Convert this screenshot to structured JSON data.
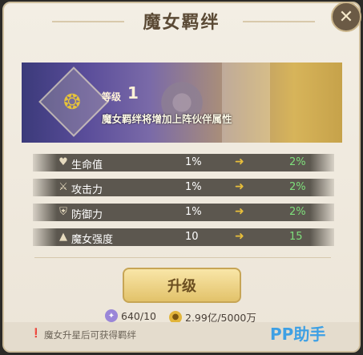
{
  "title": "魔女羁绊",
  "banner": {
    "level_label": "等级",
    "level_value": "1",
    "description": "魔女羁绊将增加上阵伙伴属性"
  },
  "stats": [
    {
      "icon": "heart-icon",
      "label": "生命值",
      "current": "1%",
      "next": "2%"
    },
    {
      "icon": "sword-icon",
      "label": "攻击力",
      "current": "1%",
      "next": "2%"
    },
    {
      "icon": "shield-icon",
      "label": "防御力",
      "current": "1%",
      "next": "2%"
    },
    {
      "icon": "witch-hat-icon",
      "label": "魔女强度",
      "current": "10",
      "next": "15"
    }
  ],
  "upgrade_label": "升级",
  "costs": [
    {
      "icon": "purple-flame-icon",
      "value": "640/10"
    },
    {
      "icon": "gold-coin-icon",
      "value": "2.99亿/5000万"
    }
  ],
  "hint": "魔女升星后可获得羁绊",
  "watermark": "PP助手",
  "colors": {
    "accent": "#e9bf3a",
    "increase": "#7fe07c",
    "row_bg": "#5c574f"
  }
}
